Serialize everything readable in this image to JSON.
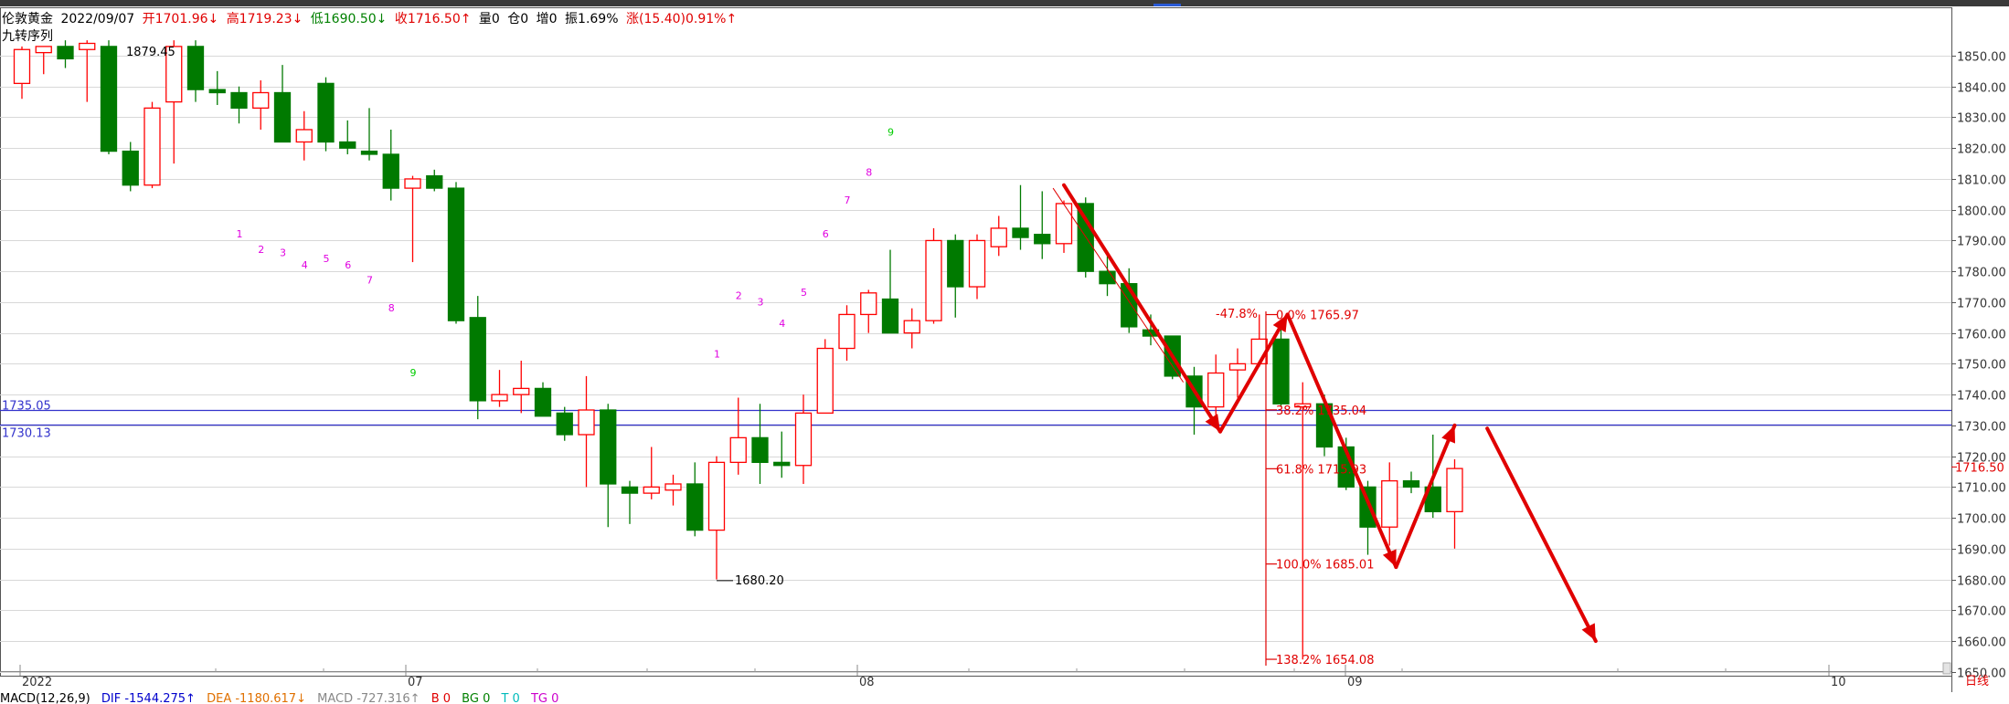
{
  "header": {
    "symbol": "伦敦黄金",
    "date": "2022/09/07",
    "open": "开1701.96↓",
    "high": "高1719.23↓",
    "low": "低1690.50↓",
    "close": "收1716.50↑",
    "volume": "量0",
    "position": "仓0",
    "increase": "增0",
    "amplitude": "振1.69%",
    "change": "涨(15.40)0.91%↑"
  },
  "indicator_label": "九转序列",
  "macd": {
    "name": "MACD(12,26,9)",
    "dif": "DIF -1544.275↑",
    "dea": "DEA -1180.617↓",
    "macd": "MACD -727.316↑",
    "b": "B 0",
    "bg": "BG 0",
    "t": "T 0",
    "tg": "TG 0"
  },
  "colors": {
    "up": "#ff0000",
    "down": "#007a00",
    "level_line": "#3333cc",
    "fib": "#e00000",
    "seq_magenta": "#e000e0",
    "seq_green": "#00cc00"
  },
  "chart_data": {
    "type": "candlestick",
    "title": "伦敦黄金",
    "period_label": "日线",
    "ylim": [
      1648,
      1855
    ],
    "yticks": [
      "1650.00",
      "1660.00",
      "1670.00",
      "1680.00",
      "1690.00",
      "1700.00",
      "1710.00",
      "1720.00",
      "1730.00",
      "1740.00",
      "1750.00",
      "1760.00",
      "1770.00",
      "1780.00",
      "1790.00",
      "1800.00",
      "1810.00",
      "1820.00",
      "1830.00",
      "1840.00",
      "1850.00"
    ],
    "xlabels": [
      "2022",
      "07",
      "08",
      "09",
      "10"
    ],
    "last_price": "1716.50",
    "candles": [
      {
        "o": 1841,
        "h": 1853,
        "l": 1836,
        "c": 1852
      },
      {
        "o": 1851,
        "h": 1853,
        "l": 1844,
        "c": 1853
      },
      {
        "o": 1853,
        "h": 1855,
        "l": 1846,
        "c": 1849
      },
      {
        "o": 1852,
        "h": 1855,
        "l": 1835,
        "c": 1854
      },
      {
        "o": 1853,
        "h": 1855,
        "l": 1818,
        "c": 1819
      },
      {
        "o": 1819,
        "h": 1822,
        "l": 1806,
        "c": 1808
      },
      {
        "o": 1808,
        "h": 1835,
        "l": 1807,
        "c": 1833
      },
      {
        "o": 1835,
        "h": 1855,
        "l": 1815,
        "c": 1853
      },
      {
        "o": 1853,
        "h": 1855,
        "l": 1835,
        "c": 1839
      },
      {
        "o": 1839,
        "h": 1845,
        "l": 1834,
        "c": 1838
      },
      {
        "o": 1838,
        "h": 1840,
        "l": 1828,
        "c": 1833
      },
      {
        "o": 1833,
        "h": 1842,
        "l": 1826,
        "c": 1838
      },
      {
        "o": 1838,
        "h": 1847,
        "l": 1822,
        "c": 1822
      },
      {
        "o": 1822,
        "h": 1832,
        "l": 1816,
        "c": 1826
      },
      {
        "o": 1841,
        "h": 1843,
        "l": 1819,
        "c": 1822
      },
      {
        "o": 1822,
        "h": 1829,
        "l": 1818,
        "c": 1820
      },
      {
        "o": 1819,
        "h": 1833,
        "l": 1816,
        "c": 1818
      },
      {
        "o": 1818,
        "h": 1826,
        "l": 1803,
        "c": 1807
      },
      {
        "o": 1807,
        "h": 1811,
        "l": 1783,
        "c": 1810
      },
      {
        "o": 1811,
        "h": 1813,
        "l": 1806,
        "c": 1807
      },
      {
        "o": 1807,
        "h": 1809,
        "l": 1763,
        "c": 1764
      },
      {
        "o": 1765,
        "h": 1772,
        "l": 1732,
        "c": 1738
      },
      {
        "o": 1738,
        "h": 1748,
        "l": 1736,
        "c": 1740
      },
      {
        "o": 1740,
        "h": 1751,
        "l": 1734,
        "c": 1742
      },
      {
        "o": 1742,
        "h": 1744,
        "l": 1733,
        "c": 1733
      },
      {
        "o": 1734,
        "h": 1736,
        "l": 1725,
        "c": 1727
      },
      {
        "o": 1727,
        "h": 1746,
        "l": 1710,
        "c": 1735
      },
      {
        "o": 1735,
        "h": 1737,
        "l": 1697,
        "c": 1711
      },
      {
        "o": 1710,
        "h": 1712,
        "l": 1698,
        "c": 1708
      },
      {
        "o": 1708,
        "h": 1723,
        "l": 1706,
        "c": 1710
      },
      {
        "o": 1709,
        "h": 1714,
        "l": 1704,
        "c": 1711
      },
      {
        "o": 1711,
        "h": 1718,
        "l": 1694,
        "c": 1696
      },
      {
        "o": 1696,
        "h": 1720,
        "l": 1680,
        "c": 1718
      },
      {
        "o": 1718,
        "h": 1739,
        "l": 1714,
        "c": 1726
      },
      {
        "o": 1726,
        "h": 1737,
        "l": 1711,
        "c": 1718
      },
      {
        "o": 1718,
        "h": 1728,
        "l": 1713,
        "c": 1717
      },
      {
        "o": 1717,
        "h": 1740,
        "l": 1711,
        "c": 1734
      },
      {
        "o": 1734,
        "h": 1758,
        "l": 1734,
        "c": 1755
      },
      {
        "o": 1755,
        "h": 1769,
        "l": 1751,
        "c": 1766
      },
      {
        "o": 1766,
        "h": 1774,
        "l": 1760,
        "c": 1773
      },
      {
        "o": 1771,
        "h": 1787,
        "l": 1760,
        "c": 1760
      },
      {
        "o": 1760,
        "h": 1768,
        "l": 1755,
        "c": 1764
      },
      {
        "o": 1764,
        "h": 1794,
        "l": 1763,
        "c": 1790
      },
      {
        "o": 1790,
        "h": 1792,
        "l": 1765,
        "c": 1775
      },
      {
        "o": 1775,
        "h": 1792,
        "l": 1771,
        "c": 1790
      },
      {
        "o": 1788,
        "h": 1798,
        "l": 1785,
        "c": 1794
      },
      {
        "o": 1794,
        "h": 1808,
        "l": 1787,
        "c": 1791
      },
      {
        "o": 1792,
        "h": 1806,
        "l": 1784,
        "c": 1789
      },
      {
        "o": 1789,
        "h": 1803,
        "l": 1786,
        "c": 1802
      },
      {
        "o": 1802,
        "h": 1804,
        "l": 1778,
        "c": 1780
      },
      {
        "o": 1780,
        "h": 1785,
        "l": 1772,
        "c": 1776
      },
      {
        "o": 1776,
        "h": 1781,
        "l": 1760,
        "c": 1762
      },
      {
        "o": 1761,
        "h": 1766,
        "l": 1756,
        "c": 1759
      },
      {
        "o": 1759,
        "h": 1759,
        "l": 1745,
        "c": 1746
      },
      {
        "o": 1746,
        "h": 1749,
        "l": 1727,
        "c": 1736
      },
      {
        "o": 1736,
        "h": 1753,
        "l": 1733,
        "c": 1747
      },
      {
        "o": 1748,
        "h": 1755,
        "l": 1739,
        "c": 1750
      },
      {
        "o": 1750,
        "h": 1766,
        "l": 1749,
        "c": 1758
      },
      {
        "o": 1758,
        "h": 1763,
        "l": 1736,
        "c": 1737
      },
      {
        "o": 1736,
        "h": 1744,
        "l": 1654,
        "c": 1737
      },
      {
        "o": 1737,
        "h": 1740,
        "l": 1720,
        "c": 1723
      },
      {
        "o": 1723,
        "h": 1726,
        "l": 1709,
        "c": 1710
      },
      {
        "o": 1710,
        "h": 1712,
        "l": 1688,
        "c": 1697
      },
      {
        "o": 1697,
        "h": 1718,
        "l": 1691,
        "c": 1712
      },
      {
        "o": 1712,
        "h": 1715,
        "l": 1708,
        "c": 1710
      },
      {
        "o": 1710,
        "h": 1727,
        "l": 1700,
        "c": 1702
      },
      {
        "o": 1702,
        "h": 1719,
        "l": 1690,
        "c": 1716
      }
    ],
    "price_labels": [
      {
        "text": "1879.45",
        "x": 5,
        "y": 1851
      },
      {
        "text": "1680.20",
        "x": 32,
        "y": 1682
      }
    ],
    "sequence_marks": [
      {
        "text": "1",
        "x": 10,
        "y": 1791,
        "color": "magenta"
      },
      {
        "text": "2",
        "x": 11,
        "y": 1786,
        "color": "magenta"
      },
      {
        "text": "3",
        "x": 12,
        "y": 1785,
        "color": "magenta"
      },
      {
        "text": "4",
        "x": 13,
        "y": 1781,
        "color": "magenta"
      },
      {
        "text": "5",
        "x": 14,
        "y": 1783,
        "color": "magenta"
      },
      {
        "text": "6",
        "x": 15,
        "y": 1781,
        "color": "magenta"
      },
      {
        "text": "7",
        "x": 16,
        "y": 1776,
        "color": "magenta"
      },
      {
        "text": "8",
        "x": 17,
        "y": 1767,
        "color": "magenta"
      },
      {
        "text": "9",
        "x": 18,
        "y": 1746,
        "color": "green"
      },
      {
        "text": "1",
        "x": 32,
        "y": 1752,
        "color": "magenta"
      },
      {
        "text": "2",
        "x": 33,
        "y": 1771,
        "color": "magenta"
      },
      {
        "text": "3",
        "x": 34,
        "y": 1769,
        "color": "magenta"
      },
      {
        "text": "4",
        "x": 35,
        "y": 1762,
        "color": "magenta"
      },
      {
        "text": "5",
        "x": 36,
        "y": 1772,
        "color": "magenta"
      },
      {
        "text": "6",
        "x": 37,
        "y": 1791,
        "color": "magenta"
      },
      {
        "text": "7",
        "x": 38,
        "y": 1802,
        "color": "magenta"
      },
      {
        "text": "8",
        "x": 39,
        "y": 1811,
        "color": "magenta"
      },
      {
        "text": "9",
        "x": 40,
        "y": 1824,
        "color": "green"
      }
    ],
    "horizontal_levels": [
      {
        "label": "1735.05",
        "value": 1735.05
      },
      {
        "label": "1730.13",
        "value": 1730.13
      }
    ],
    "fib_levels": [
      {
        "label": "-47.8%",
        "value": 1767
      },
      {
        "label": "0.0% 1765.97",
        "value": 1765.97
      },
      {
        "label": "38.2% 1735.04",
        "value": 1735.04
      },
      {
        "label": "61.8% 1715.93",
        "value": 1715.93
      },
      {
        "label": "100.0% 1685.01",
        "value": 1685.01
      },
      {
        "label": "138.2% 1654.08",
        "value": 1654.08
      }
    ],
    "arrows": [
      {
        "from": [
          48,
          1808
        ],
        "to": [
          55.2,
          1728
        ]
      },
      {
        "from": [
          55.2,
          1728
        ],
        "to": [
          58.3,
          1766
        ]
      },
      {
        "from": [
          58.3,
          1766
        ],
        "to": [
          63.3,
          1684
        ]
      },
      {
        "from": [
          63.3,
          1684
        ],
        "to": [
          66,
          1730
        ]
      },
      {
        "from": [
          67.5,
          1729
        ],
        "to": [
          72.5,
          1660
        ]
      }
    ]
  }
}
